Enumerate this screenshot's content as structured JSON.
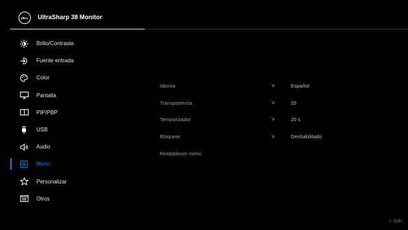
{
  "header": {
    "logo_text": "DELL",
    "title": "UltraSharp 38 Monitor"
  },
  "menu": {
    "items": [
      {
        "label": "Brillo/Contraste",
        "icon": "brightness-icon"
      },
      {
        "label": "Fuente entrada",
        "icon": "input-source-icon"
      },
      {
        "label": "Color",
        "icon": "color-palette-icon"
      },
      {
        "label": "Pantalla",
        "icon": "display-icon"
      },
      {
        "label": "PIP/PBP",
        "icon": "pip-pbp-icon"
      },
      {
        "label": "USB",
        "icon": "usb-icon"
      },
      {
        "label": "Audio",
        "icon": "speaker-icon"
      },
      {
        "label": "Menú",
        "icon": "menu-icon"
      },
      {
        "label": "Personalizar",
        "icon": "star-icon"
      },
      {
        "label": "Otros",
        "icon": "others-icon"
      }
    ],
    "selected": "Menú"
  },
  "submenu": {
    "rows": [
      {
        "label": "Idioma",
        "chevron": ">",
        "value": "Español"
      },
      {
        "label": "Transparencia",
        "chevron": ">",
        "value": "20"
      },
      {
        "label": "Temporizador",
        "chevron": ">",
        "value": "20 s"
      },
      {
        "label": "Bloquear",
        "chevron": ">",
        "value": "Deshabilitado"
      },
      {
        "label": "Restablecer menú",
        "chevron": "",
        "value": ""
      }
    ]
  },
  "footer": {
    "exit_label": "< Salir"
  },
  "colors": {
    "background": "#000000",
    "accent": "#0a84e8",
    "submenu_text": "#9a9a9a"
  }
}
